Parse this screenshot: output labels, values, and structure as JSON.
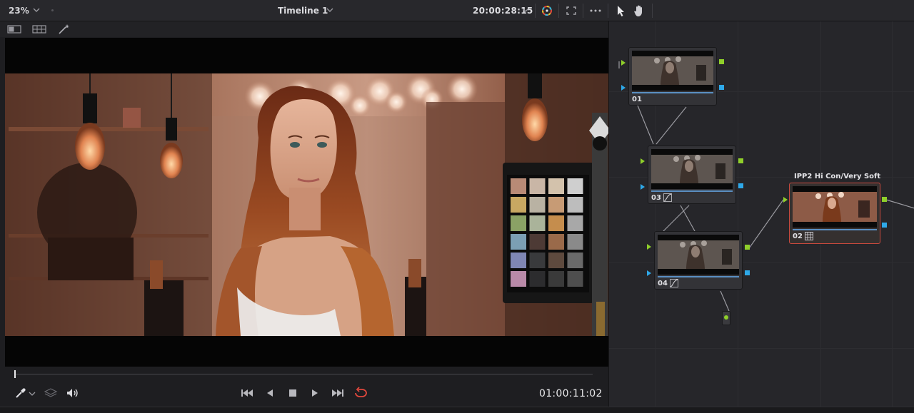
{
  "toolbar": {
    "zoom": "23%",
    "timeline_title": "Timeline 1",
    "timecode": "20:00:28:15"
  },
  "viewer": {
    "image_alt": "woman-in-studio"
  },
  "transport": {
    "timecode": "01:00:11:02",
    "scrubber_position": 0.0
  },
  "nodes": {
    "items": [
      {
        "label": "01",
        "tool_icon": ""
      },
      {
        "label": "03",
        "tool_icon": "curves-icon"
      },
      {
        "label": "04",
        "tool_icon": "curves-icon"
      },
      {
        "label": "02",
        "tool_icon": "lut-icon",
        "title": "IPP2 Hi Con/Very Soft",
        "selected": true
      }
    ]
  },
  "colors": {
    "accent_red": "#e1483d",
    "port_green": "#8fcf2a",
    "port_blue": "#2ea8e8",
    "selected_node_border": "#c8493d"
  }
}
